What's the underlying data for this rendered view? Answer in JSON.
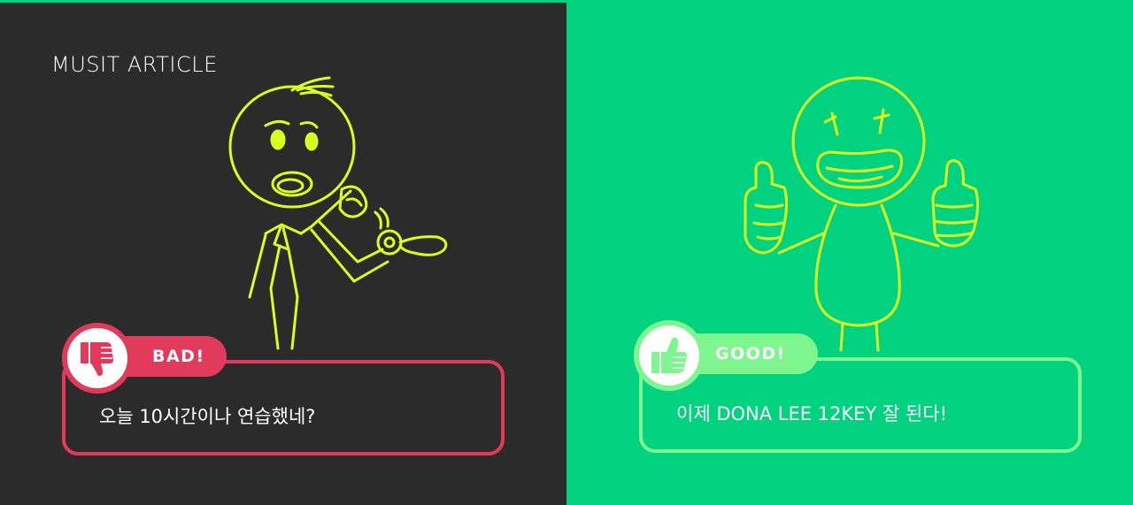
{
  "brand": {
    "name": "MUSIT ARTICLE"
  },
  "bad": {
    "badge_label": "BAD!",
    "message": "오늘 10시간이나 연습했네?",
    "accent_color": "#e23a5b",
    "icon": "thumbs-down-icon"
  },
  "good": {
    "badge_label": "GOOD!",
    "message": "이제 DONA LEE 12KEY 잘 된다!",
    "accent_color": "#7ef58f",
    "icon": "thumbs-up-icon"
  },
  "colors": {
    "dark_background": "#2b2b2b",
    "green_background": "#00d27f",
    "sketch_yellow": "#d9ff1e"
  }
}
